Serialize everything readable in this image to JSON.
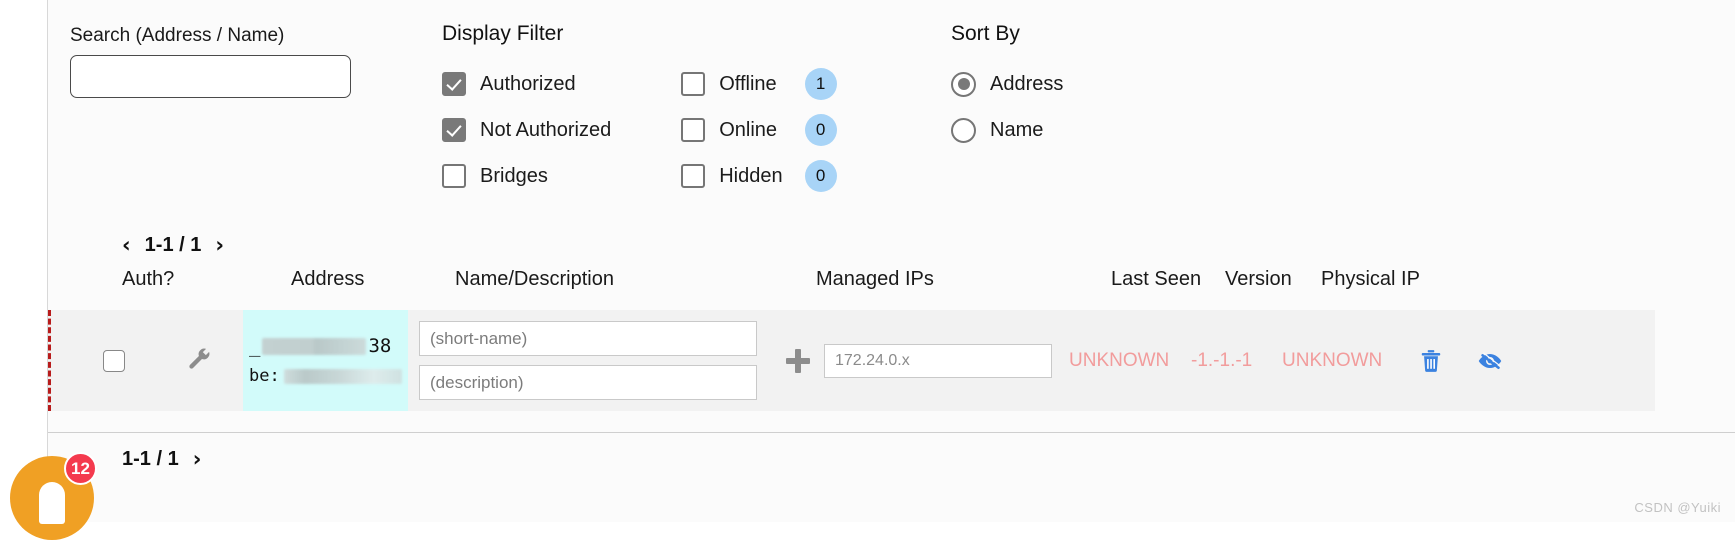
{
  "search": {
    "label": "Search (Address / Name)",
    "value": "",
    "placeholder": ""
  },
  "display_filter": {
    "title": "Display Filter",
    "options": [
      {
        "label": "Authorized",
        "checked": true
      },
      {
        "label": "Not Authorized",
        "checked": true
      },
      {
        "label": "Bridges",
        "checked": false
      },
      {
        "label": "Offline",
        "checked": false,
        "badge": "1"
      },
      {
        "label": "Online",
        "checked": false,
        "badge": "0"
      },
      {
        "label": "Hidden",
        "checked": false,
        "badge": "0"
      }
    ]
  },
  "sort_by": {
    "title": "Sort By",
    "options": [
      {
        "label": "Address",
        "selected": true
      },
      {
        "label": "Name",
        "selected": false
      }
    ]
  },
  "pagination": {
    "prev_arrow": "‹",
    "next_arrow": "›",
    "range_top": "1-1 / 1",
    "range_bottom": "1-1 / 1"
  },
  "table": {
    "headers": [
      "Auth?",
      "Address",
      "Name/Description",
      "Managed IPs",
      "Last Seen",
      "Version",
      "Physical IP"
    ],
    "rows": [
      {
        "authorized": false,
        "address_suffix": "38",
        "address_prefix": "_",
        "address_line2_label": "be:",
        "short_name_value": "",
        "short_name_placeholder": "(short-name)",
        "description_value": "",
        "description_placeholder": "(description)",
        "managed_ip_value": "",
        "managed_ip_placeholder": "172.24.0.x",
        "last_seen": "UNKNOWN",
        "version": "-1.-1.-1",
        "physical_ip": "UNKNOWN"
      }
    ]
  },
  "dock": {
    "badge_count": "12"
  },
  "watermark": "CSDN @Yuiki",
  "colors": {
    "accent_blue": "#3b82e0",
    "badge_blue": "#a8d4f7",
    "status_red": "#f29c9c",
    "row_marker_red": "#b81b1b",
    "address_cell": "#d2fbfa",
    "row_background": "#f2f2f2",
    "dock_orange": "#f0a024",
    "dock_badge_red": "#f43a4e"
  }
}
